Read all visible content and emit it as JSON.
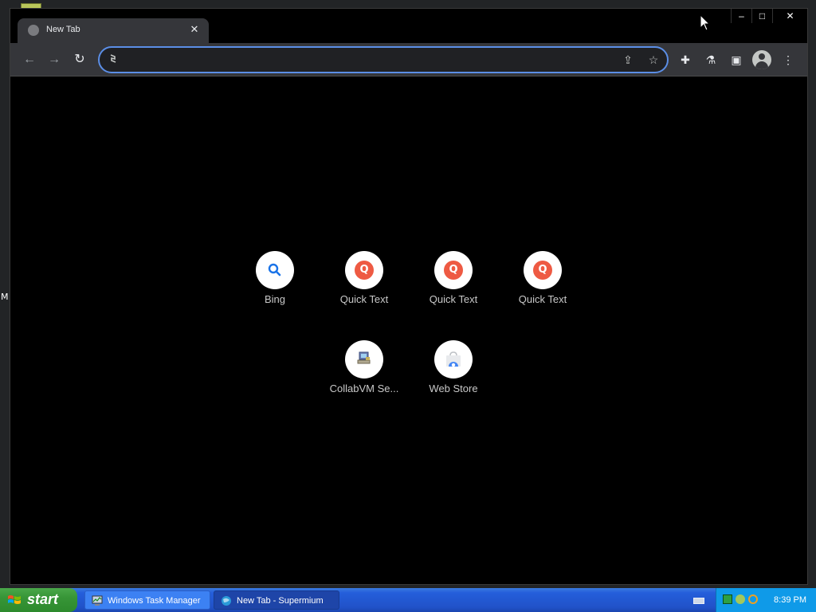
{
  "desktop": {
    "edge_letter": "M"
  },
  "browser": {
    "tab": {
      "title": "New Tab",
      "close_glyph": "✕"
    },
    "window_controls": {
      "minimize": "–",
      "maximize": "□",
      "close": "✕"
    },
    "toolbar": {
      "back_glyph": "←",
      "forward_glyph": "→",
      "reload_glyph": "↻",
      "address_value": "",
      "address_placeholder": "",
      "share_glyph": "⇪",
      "bookmark_glyph": "☆",
      "extensions_glyph": "✚",
      "labs_glyph": "⚗",
      "sidepanel_glyph": "▣",
      "menu_glyph": "⋮"
    },
    "shortcuts": [
      {
        "label": "Bing",
        "icon": "search-icon"
      },
      {
        "label": "Quick Text",
        "icon": "q-icon",
        "badge": "Q"
      },
      {
        "label": "Quick Text",
        "icon": "q-icon",
        "badge": "Q"
      },
      {
        "label": "Quick Text",
        "icon": "q-icon",
        "badge": "Q"
      },
      {
        "label": "CollabVM Se...",
        "icon": "computer-icon"
      },
      {
        "label": "Web Store",
        "icon": "web-store-icon"
      }
    ]
  },
  "taskbar": {
    "start_label": "start",
    "tasks": [
      {
        "label": "Windows Task Manager",
        "icon": "task-manager-icon",
        "active": false
      },
      {
        "label": "New Tab - Supermium",
        "icon": "browser-icon",
        "active": true
      }
    ],
    "clock": "8:39 PM"
  },
  "colors": {
    "accent": "#5b8ee6",
    "toolbar_bg": "#35363a",
    "quick_text_red": "#ee5a43",
    "taskbar_blue": "#245edb",
    "start_green": "#379537"
  }
}
